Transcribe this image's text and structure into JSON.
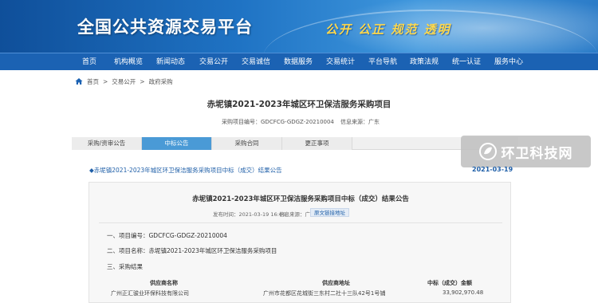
{
  "site": {
    "title": "全国公共资源交易平台",
    "slogan": "公开 公正 规范 透明"
  },
  "nav": {
    "items": [
      "首页",
      "机构概览",
      "新闻动态",
      "交易公开",
      "交易诚信",
      "数据服务",
      "交易统计",
      "平台导航",
      "政策法规",
      "统一认证",
      "服务中心"
    ]
  },
  "breadcrumb": {
    "items": [
      "首页",
      ">",
      "交易公开",
      ">",
      "政府采购"
    ]
  },
  "page": {
    "title": "赤坭镇2021-2023年城区环卫保洁服务采购项目",
    "project_no_label": "采购项目编号：GDCFCG-GDGZ-20210004",
    "source_label": "信息来源：广东"
  },
  "tabs": {
    "items": [
      "采购/资审公告",
      "中标公告",
      "采购合同",
      "更正事项"
    ],
    "active_index": 1
  },
  "notice": {
    "title": "◆赤坭镇2021-2023年城区环卫保洁服务采购项目中标（成交）结果公告",
    "date": "2021-03-19"
  },
  "watermark": {
    "text": "环卫科技网"
  },
  "panel": {
    "title": "赤坭镇2021-2023年城区环卫保洁服务采购项目中标（成交）结果公告",
    "publish_time": "发布时间：2021-03-19 16:46",
    "source": "信息来源：广东",
    "link_label": "原文链接地址",
    "sections": [
      "一、项目编号：GDCFCG-GDGZ-20210004",
      "二、项目名称：赤坭镇2021-2023年城区环卫保洁服务采购项目",
      "三、采购结果"
    ],
    "table": {
      "headers": [
        "供应商名称",
        "供应商地址",
        "中标（成交）金额"
      ],
      "rows": [
        [
          "广州正汇骏业环保科技有限公司",
          "广州市花都区花城街三东村二社十三队42号1号铺",
          "33,902,970.48"
        ]
      ]
    }
  },
  "colors": {
    "banner": "#1f73c4",
    "nav": "#1b62b3",
    "active_tab": "#4a9ad6",
    "link": "#1f5fa8",
    "slogan": "#ffd84a"
  }
}
